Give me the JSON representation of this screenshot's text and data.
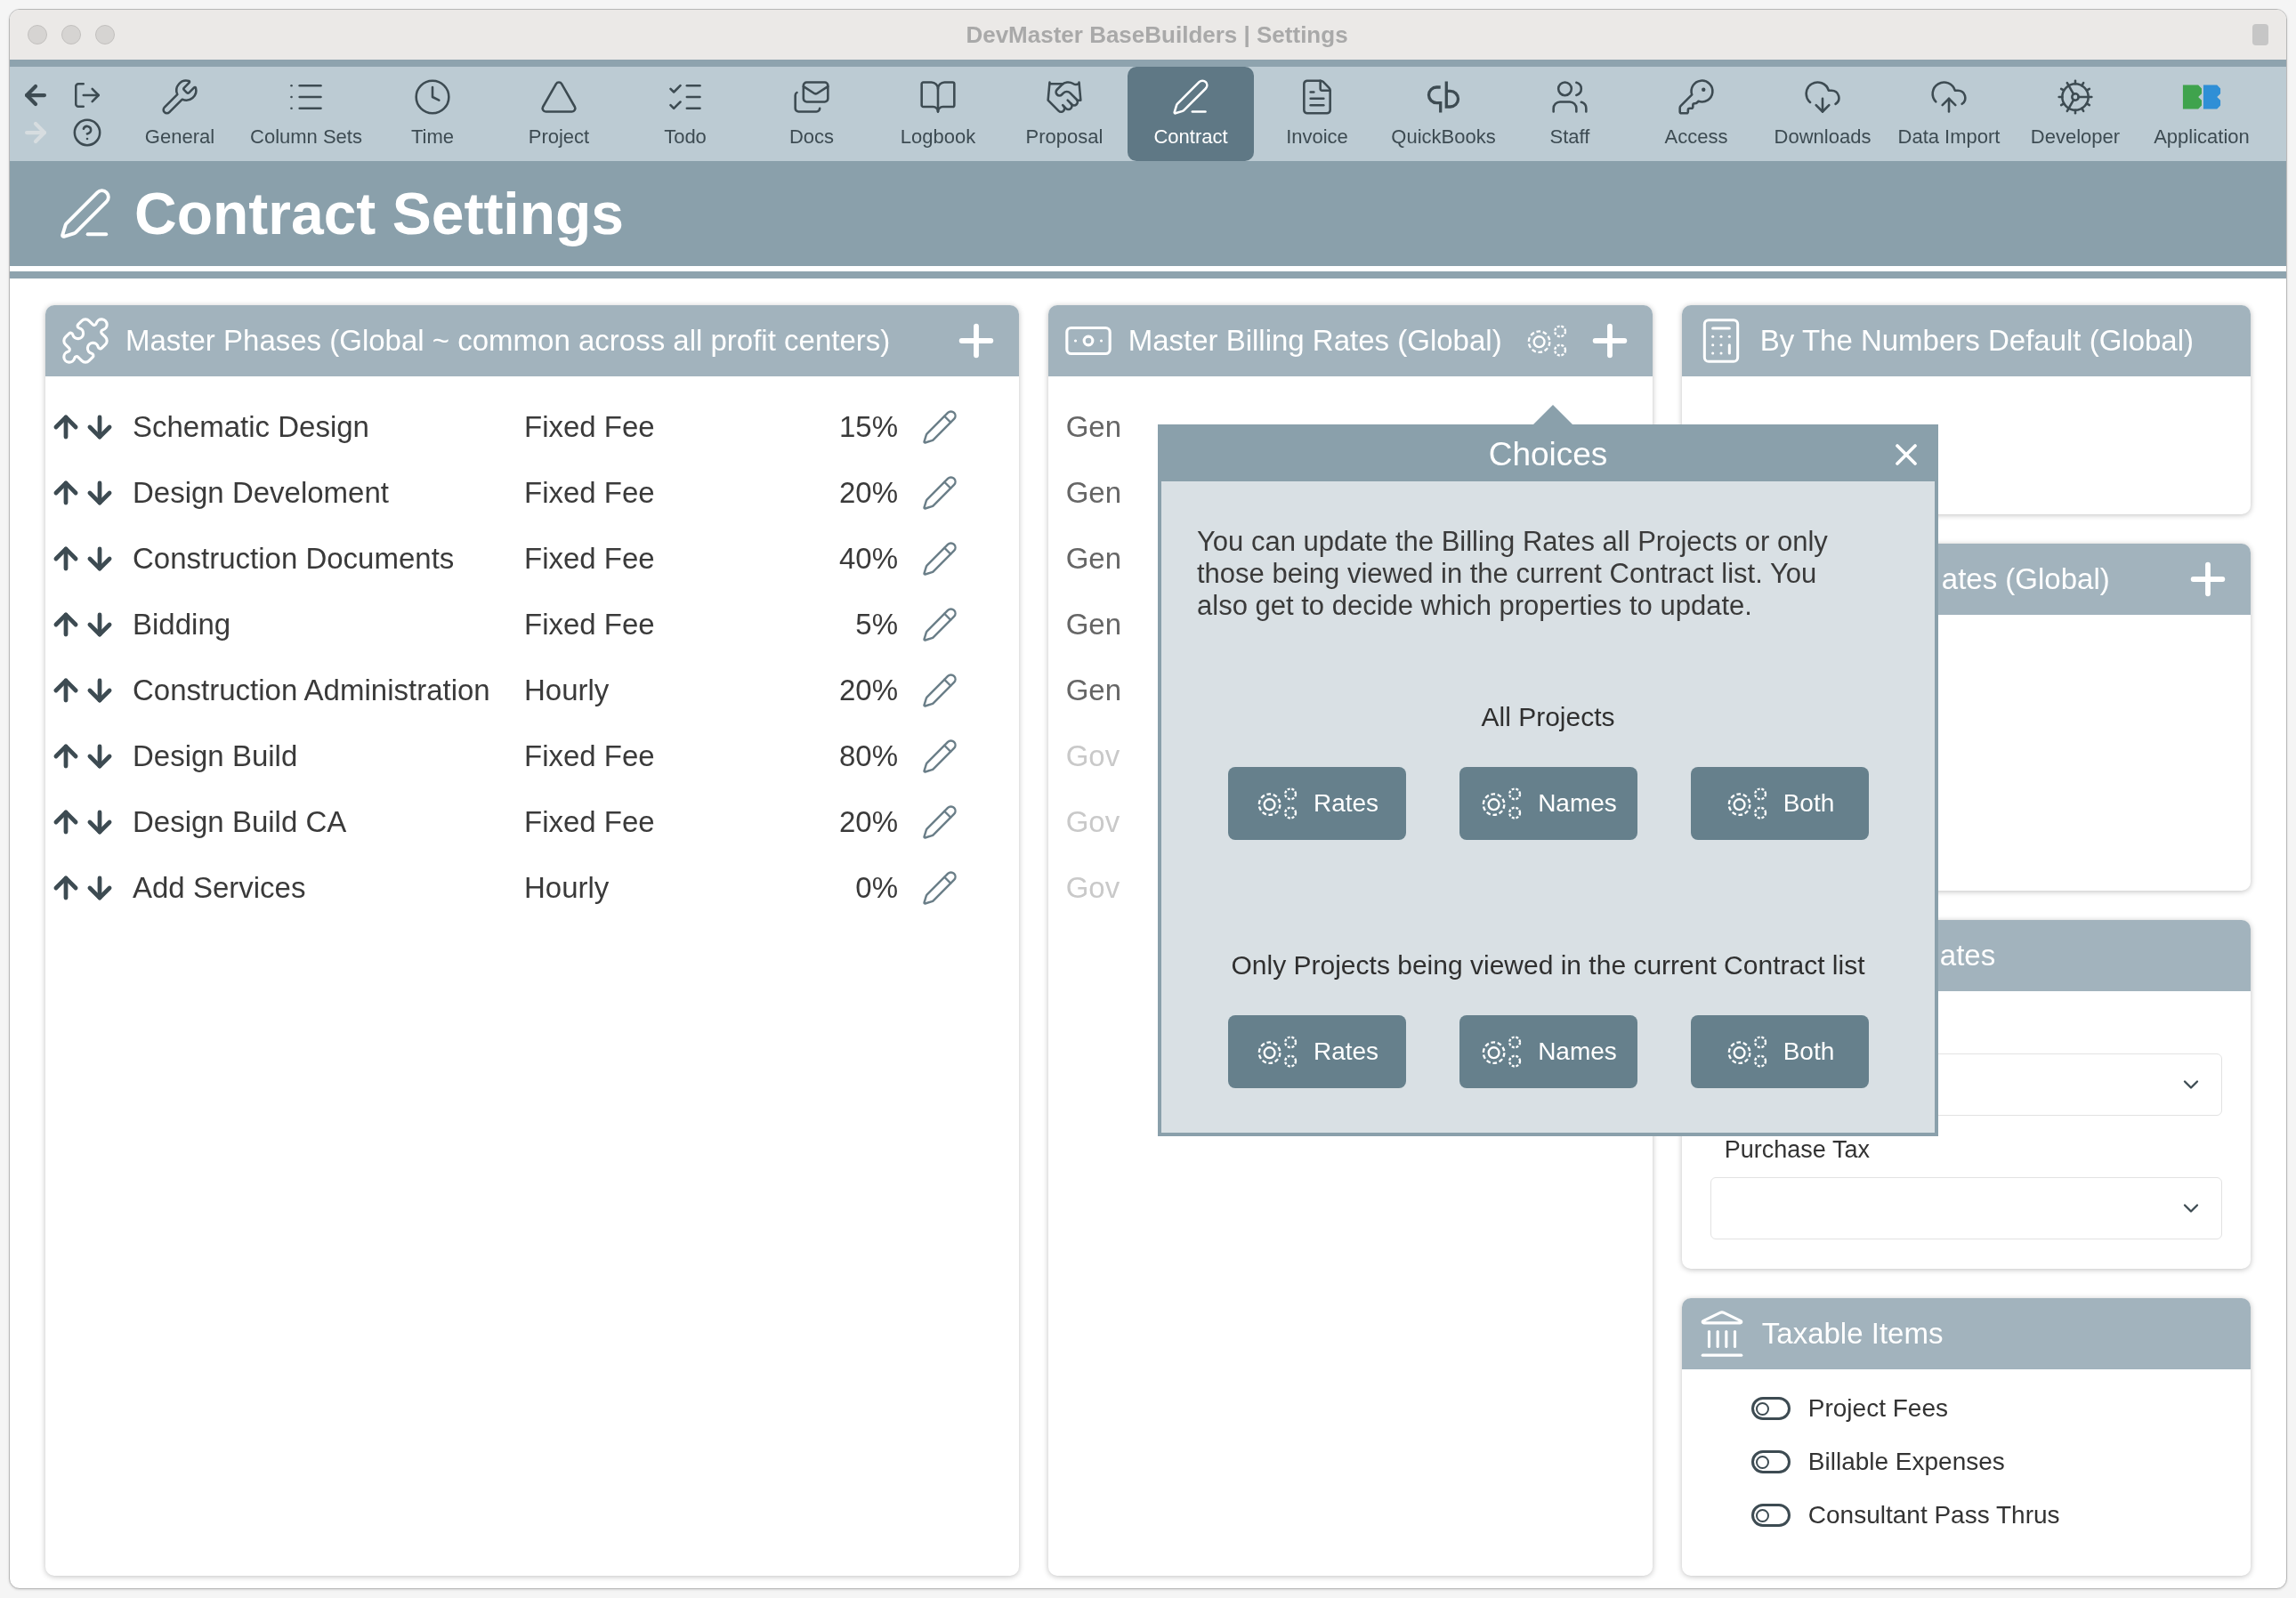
{
  "window": {
    "title": "DevMaster BaseBuilders | Settings"
  },
  "toolbar": {
    "nav": [
      {
        "kind": "back",
        "disabled": false
      },
      {
        "kind": "exit",
        "disabled": false
      },
      {
        "kind": "forward",
        "disabled": true
      },
      {
        "kind": "help",
        "disabled": false
      }
    ],
    "items": [
      {
        "label": "General",
        "selected": false
      },
      {
        "label": "Column Sets",
        "selected": false
      },
      {
        "label": "Time",
        "selected": false
      },
      {
        "label": "Project",
        "selected": false
      },
      {
        "label": "Todo",
        "selected": false
      },
      {
        "label": "Docs",
        "selected": false
      },
      {
        "label": "Logbook",
        "selected": false
      },
      {
        "label": "Proposal",
        "selected": false
      },
      {
        "label": "Contract",
        "selected": true
      },
      {
        "label": "Invoice",
        "selected": false
      },
      {
        "label": "QuickBooks",
        "selected": false
      },
      {
        "label": "Staff",
        "selected": false
      },
      {
        "label": "Access",
        "selected": false
      },
      {
        "label": "Downloads",
        "selected": false
      },
      {
        "label": "Data Import",
        "selected": false
      },
      {
        "label": "Developer",
        "selected": false
      },
      {
        "label": "Application",
        "selected": false
      }
    ]
  },
  "page_title": "Contract Settings",
  "master_phases": {
    "title": "Master Phases (Global ~ common across all profit centers)",
    "rows": [
      {
        "name": "Schematic Design",
        "type": "Fixed Fee",
        "percent": "15%"
      },
      {
        "name": "Design Develoment",
        "type": "Fixed Fee",
        "percent": "20%"
      },
      {
        "name": "Construction Documents",
        "type": "Fixed Fee",
        "percent": "40%"
      },
      {
        "name": "Bidding",
        "type": "Fixed Fee",
        "percent": "5%"
      },
      {
        "name": "Construction Administration",
        "type": "Hourly",
        "percent": "20%"
      },
      {
        "name": "Design Build",
        "type": "Fixed Fee",
        "percent": "80%"
      },
      {
        "name": "Design Build CA",
        "type": "Fixed Fee",
        "percent": "20%"
      },
      {
        "name": "Add Services",
        "type": "Hourly",
        "percent": "0%"
      }
    ]
  },
  "billing_rates": {
    "title": "Master Billing Rates (Global)",
    "rows": [
      {
        "label": "Gen",
        "disabled": false
      },
      {
        "label": "Gen",
        "disabled": false
      },
      {
        "label": "Gen",
        "disabled": false
      },
      {
        "label": "Gen",
        "disabled": false
      },
      {
        "label": "Gen",
        "disabled": false
      },
      {
        "label": "Gov",
        "disabled": true
      },
      {
        "label": "Gov",
        "disabled": true
      },
      {
        "label": "Gov",
        "disabled": true
      }
    ]
  },
  "by_the_numbers": {
    "title": "By The Numbers Default (Global)"
  },
  "card_2": {
    "title": "ates (Global)"
  },
  "card_3": {
    "title": "ates",
    "fields": [
      {
        "label": "Purchase Tax"
      }
    ]
  },
  "taxable_items": {
    "title": "Taxable Items",
    "items": [
      {
        "label": "Project Fees",
        "on": false
      },
      {
        "label": "Billable Expenses",
        "on": false
      },
      {
        "label": "Consultant Pass Thrus",
        "on": false
      }
    ]
  },
  "popover": {
    "title": "Choices",
    "text": "You can update the Billing Rates all Projects or only those being viewed in the current Contract list. You also get to decide which properties to update.",
    "groups": [
      {
        "heading": "All Projects",
        "buttons": [
          "Rates",
          "Names",
          "Both"
        ]
      },
      {
        "heading": "Only Projects being viewed in the current Contract list",
        "buttons": [
          "Rates",
          "Names",
          "Both"
        ]
      }
    ]
  }
}
